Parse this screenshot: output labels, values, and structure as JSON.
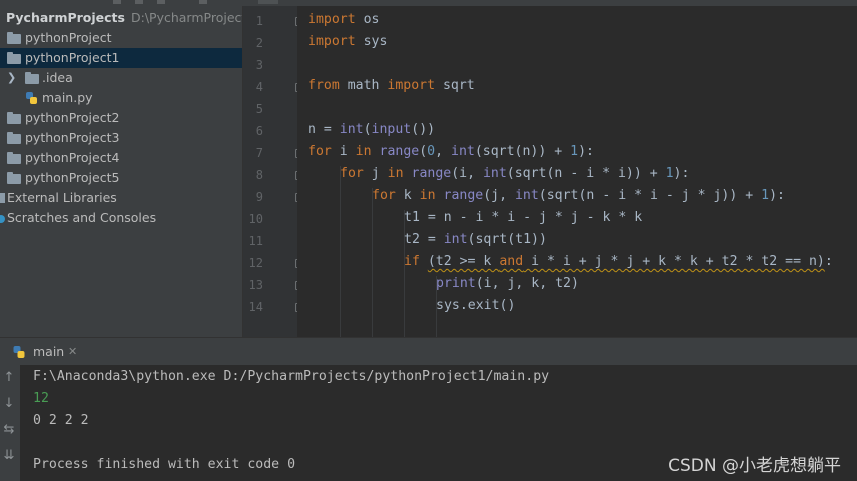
{
  "project_tree": {
    "root": {
      "label": "PycharmProjects",
      "path": "D:\\PycharmProjects"
    },
    "items": [
      {
        "label": "pythonProject",
        "kind": "folder",
        "selected": false
      },
      {
        "label": "pythonProject1",
        "kind": "folder",
        "selected": true
      },
      {
        "label": ".idea",
        "kind": "folder",
        "selected": false
      },
      {
        "label": "main.py",
        "kind": "python-file",
        "selected": false
      },
      {
        "label": "pythonProject2",
        "kind": "folder",
        "selected": false
      },
      {
        "label": "pythonProject3",
        "kind": "folder",
        "selected": false
      },
      {
        "label": "pythonProject4",
        "kind": "folder",
        "selected": false
      },
      {
        "label": "pythonProject5",
        "kind": "folder",
        "selected": false
      },
      {
        "label": "External Libraries",
        "kind": "library",
        "selected": false
      },
      {
        "label": "Scratches and Consoles",
        "kind": "scratch",
        "selected": false
      }
    ]
  },
  "editor": {
    "line_numbers": [
      "1",
      "2",
      "3",
      "4",
      "5",
      "6",
      "7",
      "8",
      "9",
      "10",
      "11",
      "12",
      "13",
      "14"
    ],
    "lines": {
      "l1": {
        "kw": "import",
        "t": " os"
      },
      "l2": {
        "kw": "import",
        "t": " sys"
      },
      "l4": {
        "kw1": "from",
        "t1": " math ",
        "kw2": "import",
        "t2": " sqrt"
      },
      "l6": {
        "a": "n = ",
        "f1": "int",
        "b": "(",
        "f2": "input",
        "c": "())"
      },
      "l7": {
        "k1": "for",
        "a": " i ",
        "k2": "in",
        "b": " ",
        "f1": "range",
        "c": "(",
        "n1": "0",
        "d": ", ",
        "f2": "int",
        "e": "(sqrt(n)) + ",
        "n2": "1",
        "g": "):"
      },
      "l8": {
        "k1": "for",
        "a": " j ",
        "k2": "in",
        "b": " ",
        "f1": "range",
        "c": "(i, ",
        "f2": "int",
        "d": "(sqrt(n - i * i)) + ",
        "n1": "1",
        "e": "):"
      },
      "l9": {
        "k1": "for",
        "a": " k ",
        "k2": "in",
        "b": " ",
        "f1": "range",
        "c": "(j, ",
        "f2": "int",
        "d": "(sqrt(n - i * i - j * j)) + ",
        "n1": "1",
        "e": "):"
      },
      "l10": {
        "t": "t1 = n - i * i - j * j - k * k"
      },
      "l11": {
        "a": "t2 = ",
        "f1": "int",
        "b": "(sqrt(t1))"
      },
      "l12": {
        "k1": "if",
        "a": " ",
        "s1": "(t2 >= k ",
        "k2": "and",
        "s2": " i * i + j * j + k * k + t2 * t2 == n)",
        "b": ":"
      },
      "l13": {
        "f1": "print",
        "a": "(i, j, k, t2)"
      },
      "l14": {
        "t": "sys.exit()"
      }
    }
  },
  "run_panel": {
    "tab_label": "main",
    "output_lines": [
      {
        "text": "F:\\Anaconda3\\python.exe D:/PycharmProjects/pythonProject1/main.py",
        "style": "normal"
      },
      {
        "text": "12",
        "style": "input"
      },
      {
        "text": "0 2 2 2",
        "style": "normal"
      },
      {
        "text": "",
        "style": "normal"
      },
      {
        "text": "Process finished with exit code 0",
        "style": "normal"
      }
    ]
  },
  "watermark": "CSDN @小老虎想躺平",
  "colors": {
    "keyword": "#cc7832",
    "builtin": "#8888c6",
    "number": "#6897bb",
    "text": "#a9b7c6",
    "console_input": "#499c54",
    "selection": "#0d293e"
  }
}
